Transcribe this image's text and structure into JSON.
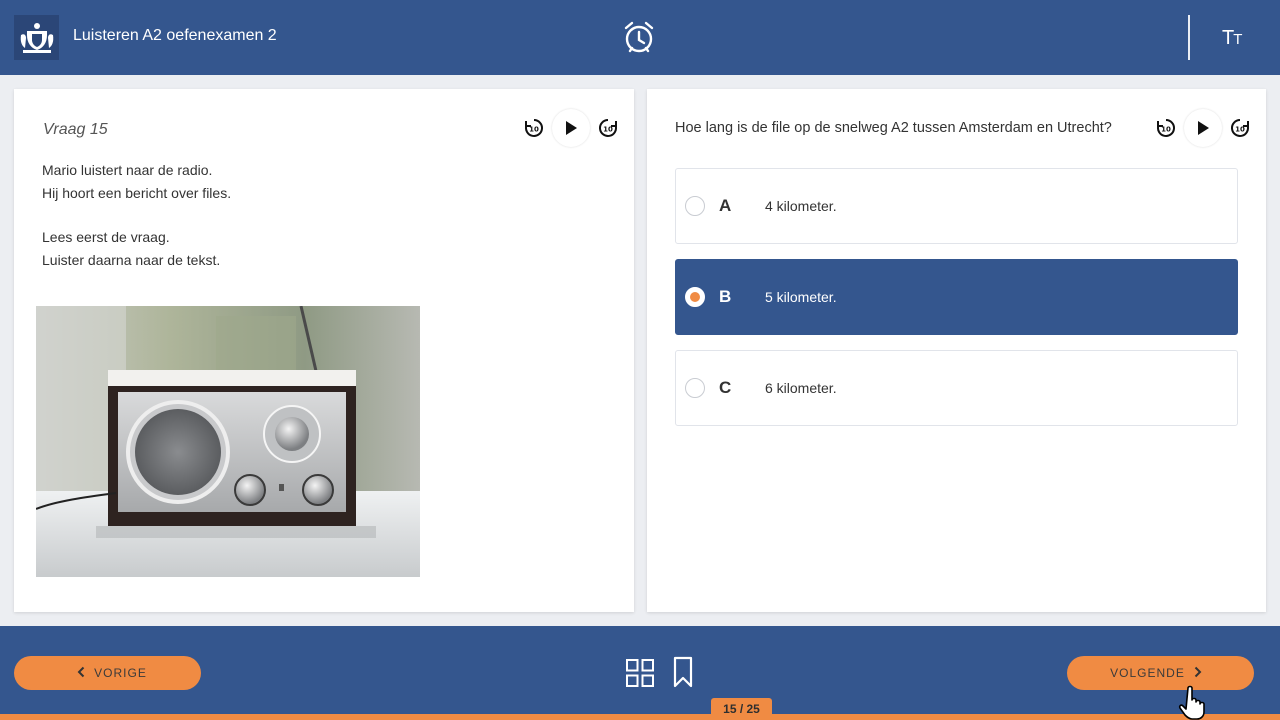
{
  "header": {
    "title": "Luisteren A2 oefenexamen 2",
    "textsize_label_big": "T",
    "textsize_label_small": "T"
  },
  "left_panel": {
    "question_number": "Vraag 15",
    "intro_paragraph_1": "Mario luistert naar de radio.\nHij hoort een bericht over files.",
    "intro_paragraph_2": "Lees eerst de vraag.\nLuister daarna naar de tekst.",
    "skip_back_label": "10",
    "skip_forward_label": "10"
  },
  "right_panel": {
    "question": "Hoe lang is de file op de snelweg A2 tussen Amsterdam en Utrecht?",
    "skip_back_label": "10",
    "skip_forward_label": "10",
    "options": [
      {
        "letter": "A",
        "text": "4 kilometer.",
        "selected": false
      },
      {
        "letter": "B",
        "text": "5 kilometer.",
        "selected": true
      },
      {
        "letter": "C",
        "text": "6 kilometer.",
        "selected": false
      }
    ]
  },
  "footer": {
    "prev_label": "VORIGE",
    "next_label": "VOLGENDE",
    "page_counter": "15 / 25"
  },
  "colors": {
    "brand_blue": "#34568e",
    "accent_orange": "#f08b43"
  }
}
